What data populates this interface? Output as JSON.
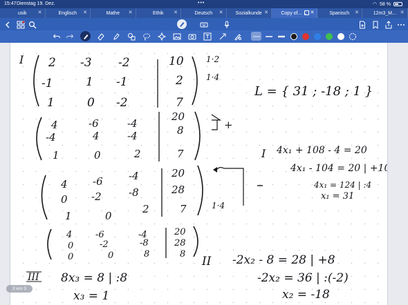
{
  "status": {
    "time": "15:47",
    "date": "Dienstag 19. Dez.",
    "battery": "58 %"
  },
  "tabs": [
    {
      "label": "usik"
    },
    {
      "label": "Englisch"
    },
    {
      "label": "Mathe"
    },
    {
      "label": "Ethik"
    },
    {
      "label": "Deutsch"
    },
    {
      "label": "Sozialkunde"
    },
    {
      "label": "Copy of... ⌄"
    },
    {
      "label": "Spanisch"
    },
    {
      "label": "12m3_M..."
    }
  ],
  "page_indicator": "3 von 3",
  "toolbar": {
    "pen_colors": [
      "#1a1a1a",
      "#e0342e",
      "#2f7fe6",
      "#3fbf4f",
      "#ffffff"
    ]
  },
  "notes": {
    "roman_I": "I",
    "roman_II": "II",
    "roman_III": "III",
    "m1": [
      [
        "2",
        "-3",
        "-2",
        "10"
      ],
      [
        "-1",
        "1",
        "-1",
        "2"
      ],
      [
        "1",
        "0",
        "-2",
        "7"
      ]
    ],
    "m1_ops": [
      "1·2",
      "1·4"
    ],
    "m2": [
      [
        "4",
        "-6",
        "-4",
        "20"
      ],
      [
        "-4",
        "4",
        "-4",
        "8"
      ],
      [
        "1",
        "0",
        "2",
        "7"
      ]
    ],
    "m2_op": "+",
    "m3": [
      [
        "4",
        "-6",
        "-4",
        "20"
      ],
      [
        "0",
        "-2",
        "-8",
        "28"
      ],
      [
        "1",
        "0",
        "2",
        "7"
      ]
    ],
    "m3_op": "1·4",
    "m4": [
      [
        "4",
        "-6",
        "-4",
        "20"
      ],
      [
        "0",
        "-2",
        "-8",
        "28"
      ],
      [
        "0",
        "0",
        "8",
        "8"
      ]
    ],
    "solution_set": "L = { 31 ; -18 ; 1 }",
    "eqI": [
      "4x₁ + 108 - 4 = 20",
      "4x₁ - 104 = 20 | +104",
      "4x₁ = 124 | :4",
      "x₁ = 31"
    ],
    "eqII": [
      "-2x₂ - 8 = 28 | +8",
      "-2x₂ = 36 | :(-2)",
      "x₂ = -18"
    ],
    "eqIII": [
      "8x₃ = 8 | :8",
      "x₃ = 1"
    ]
  }
}
